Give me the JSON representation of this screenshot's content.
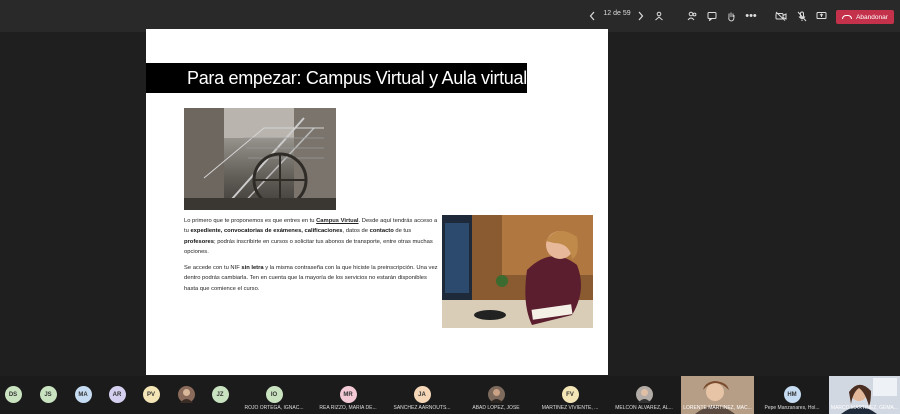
{
  "toolbar": {
    "page_counter": "12 de 59",
    "leave_label": "Abandonar",
    "colors": {
      "leave": "#c4314b",
      "bar": "#292929"
    }
  },
  "slide": {
    "title": "Para empezar: Campus Virtual y Aula virtual",
    "paragraph1": {
      "t1": "Lo primero que te proponemos es que entres en tu ",
      "link": "Campus Virtual",
      "t2": ". Desde aquí tendrás acceso a tu ",
      "b1": "expediente, convocatorias de exámenes, calificaciones",
      "t3": ", datos de ",
      "b2": "contacto",
      "t4": " de tus ",
      "b3": "profesores",
      "t5": "; podrás inscribirte en cursos o solicitar tus abonos de transporte, entre otras muchas opciones."
    },
    "paragraph2": {
      "t1": "Se accede con tu NIF ",
      "b1": "sin letra",
      "t2": " y la misma contraseña con la que hiciste la preinscripción. Una vez dentro podrás cambiarla. Ten en cuenta que la mayoría de los servicios no estarán disponibles hasta que comience el curso."
    }
  },
  "participants": [
    {
      "initials": "DS",
      "color": "#c9e3c0",
      "name": ""
    },
    {
      "initials": "JS",
      "color": "#c9e3c0",
      "name": ""
    },
    {
      "initials": "MA",
      "color": "#c5dcf2",
      "name": ""
    },
    {
      "initials": "AR",
      "color": "#d5d0ef",
      "name": ""
    },
    {
      "initials": "PV",
      "color": "#f3e5b5",
      "name": ""
    },
    {
      "initials": "",
      "color": "#8a6a5a",
      "name": ""
    },
    {
      "initials": "JZ",
      "color": "#c9e3c0",
      "name": ""
    },
    {
      "initials": "IO",
      "color": "#c9e3c0",
      "name": "ROJO ORTEGA, IGNAC..."
    },
    {
      "initials": "MR",
      "color": "#f2c9d4",
      "name": "REA RIZZO, MARÍA DE..."
    },
    {
      "initials": "JA",
      "color": "#f5d7b8",
      "name": "SÁNCHEZ AARNOUTS..."
    },
    {
      "initials": "",
      "color": "#7d6a5d",
      "name": "ABAD LÓPEZ, JOSÉ"
    },
    {
      "initials": "FV",
      "color": "#f3e5b5",
      "name": "MARTÍNEZ VIVIENTE, ..."
    },
    {
      "initials": "",
      "color": "#b3aca6",
      "name": "MELCÓN ÁLVAREZ, AL..."
    },
    {
      "initials": "",
      "color": "",
      "name": "LORENTE MARTÍNEZ, MAC..."
    },
    {
      "initials": "HM",
      "color": "#c5dcf2",
      "name": "Pepe Manzanares, Hol..."
    },
    {
      "initials": "",
      "color": "",
      "name": "MARCO MARTÍNEZ, GEMA..."
    }
  ]
}
